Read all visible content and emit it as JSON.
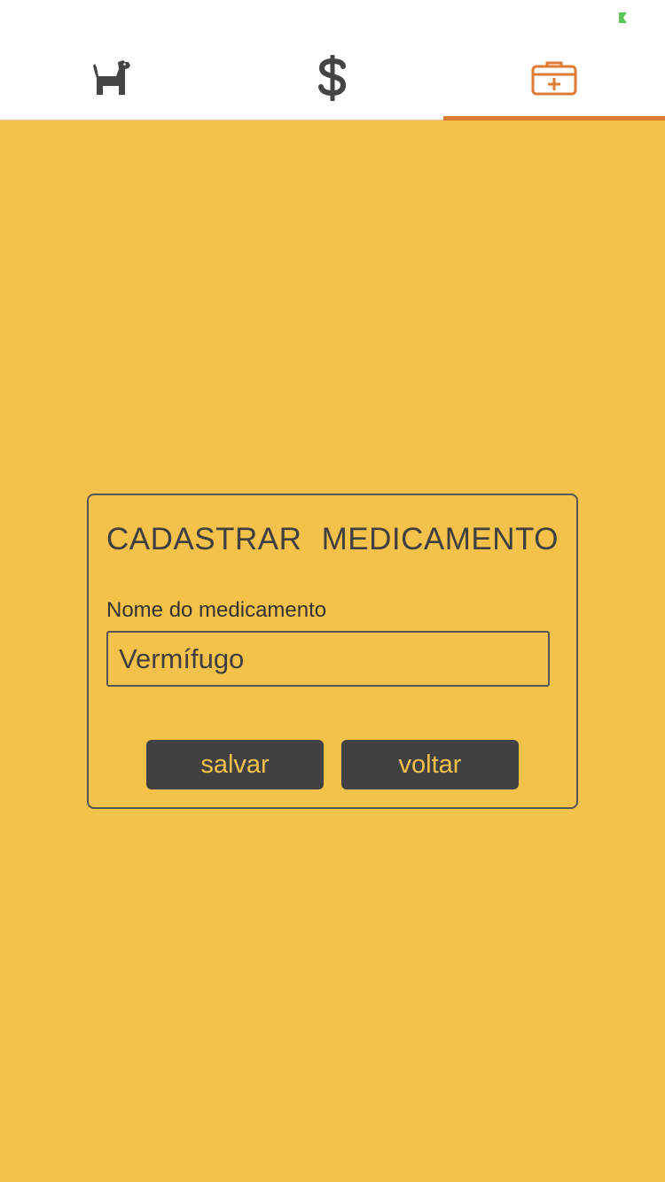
{
  "status_bar": {
    "battery_icon": "battery-charging-icon",
    "battery_color": "#5ac85a"
  },
  "tabs": [
    {
      "icon": "dog-icon",
      "active": false
    },
    {
      "icon": "dollar-icon",
      "active": false
    },
    {
      "icon": "medical-kit-icon",
      "active": true
    }
  ],
  "colors": {
    "background": "#f4c14b",
    "tab_icon": "#444444",
    "tab_active": "#e07b33",
    "button": "#414141",
    "button_text": "#f4c14b"
  },
  "form": {
    "title_word_1": "CADASTRAR",
    "title_word_2": "MEDICAMENTO",
    "name_label": "Nome do medicamento",
    "name_value": "Vermífugo",
    "save_label": "salvar",
    "back_label": "voltar"
  }
}
